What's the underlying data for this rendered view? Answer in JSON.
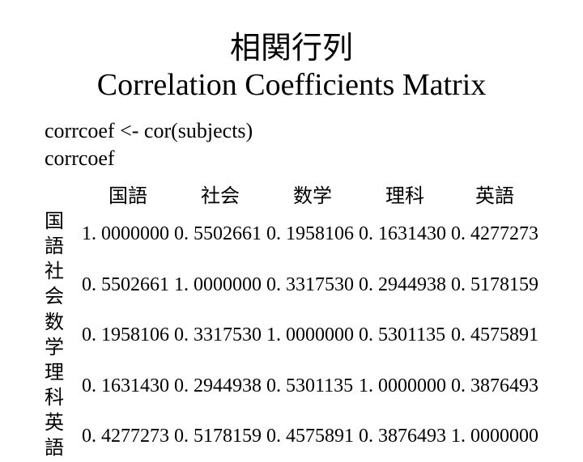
{
  "title_jp": "相関行列",
  "title_en": "Correlation Coefficients Matrix",
  "code_line1": "corrcoef <- cor(subjects)",
  "code_line2": "corrcoef",
  "chart_data": {
    "type": "table",
    "title": "Correlation Coefficients Matrix",
    "row_labels": [
      "国語",
      "社会",
      "数学",
      "理科",
      "英語"
    ],
    "col_labels": [
      "国語",
      "社会",
      "数学",
      "理科",
      "英語"
    ],
    "values": [
      [
        "1. 0000000",
        "0. 5502661",
        "0. 1958106",
        "0. 1631430",
        "0. 4277273"
      ],
      [
        "0. 5502661",
        "1. 0000000",
        "0. 3317530",
        "0. 2944938",
        "0. 5178159"
      ],
      [
        "0. 1958106",
        "0. 3317530",
        "1. 0000000",
        "0. 5301135",
        "0. 4575891"
      ],
      [
        "0. 1631430",
        "0. 2944938",
        "0. 5301135",
        "1. 0000000",
        "0. 3876493"
      ],
      [
        "0. 4277273",
        "0. 5178159",
        "0. 4575891",
        "0. 3876493",
        "1. 0000000"
      ]
    ]
  }
}
